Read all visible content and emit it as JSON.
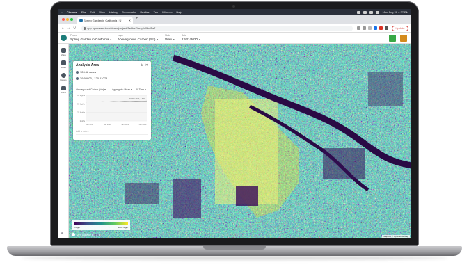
{
  "menubar": {
    "app": "Chrome",
    "items": [
      "File",
      "Edit",
      "View",
      "History",
      "Bookmarks",
      "Profiles",
      "Tab",
      "Window",
      "Help"
    ],
    "clock": "Mon Aug 28 4:37 PM"
  },
  "browser": {
    "tab_title": "Spring Garden in California | U",
    "url": "app.upstream.tech/demo/project/1e8be7/map/c0fbd1a7"
  },
  "header": {
    "project_label": "Project",
    "project_value": "Spring Garden in California",
    "layer_label": "Layer",
    "layer_value": "Aboveground Carbon (t/m)",
    "mode_label": "Mode",
    "mode_value": "View",
    "date_label": "Date",
    "date_value": "12/31/2020"
  },
  "sidebar": {
    "items": [
      {
        "label": "Share"
      },
      {
        "label": "Notes"
      },
      {
        "label": "Details"
      },
      {
        "label": "Alerts"
      }
    ]
  },
  "panel": {
    "title": "Analysis Area",
    "area": "124.58 acres",
    "coords": "39.95803, -120.61078",
    "layer_select": "Aboveground Carbon (t/m)",
    "aggregate_select": "Aggregate: Mean",
    "time_select": "All Time",
    "note_placeholder": "Add a note..."
  },
  "chart_data": {
    "type": "line",
    "title": "",
    "x": [
      "Jan 2017",
      "Jan 2018",
      "Jan 2019",
      "Jan 2020"
    ],
    "y_ticks": [
      "35 Mg/ha",
      "30 Mg/ha",
      "25 Mg/ha",
      "Mg/ha"
    ],
    "ylim": [
      20,
      35
    ],
    "series": [
      {
        "values": [
          31,
          31.2,
          31.1,
          31.3,
          31.2,
          31.4,
          31.3,
          31.5,
          31.4,
          31.6,
          31.5,
          31.7
        ]
      }
    ],
    "annotation": "33.7k t 2020, 1.76%",
    "grid": true,
    "legend": "none"
  },
  "map": {
    "attribution": "Mapbox © OpenStreetMap",
    "colorbar_low": "0 Mg/h",
    "colorbar_high": "100+ Mg/h",
    "brand": "UPSTREAM",
    "brand_pill": "Beta"
  },
  "colors": {
    "viridis_low": "#440154",
    "viridis_high": "#fde725",
    "accent": "#1b7c79",
    "update": "#d9534f"
  }
}
